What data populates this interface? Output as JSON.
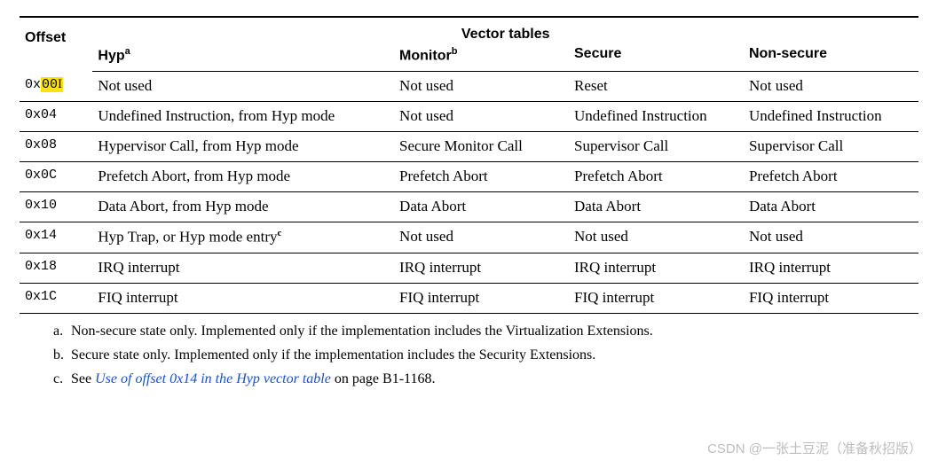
{
  "title": "Vector tables",
  "offset_header": "Offset",
  "columns": [
    {
      "label": "Hyp",
      "sup": "a"
    },
    {
      "label": "Monitor",
      "sup": "b"
    },
    {
      "label": "Secure",
      "sup": ""
    },
    {
      "label": "Non-secure",
      "sup": ""
    }
  ],
  "rows": [
    {
      "offset": "0x00",
      "offset_highlight": true,
      "hyp": "Not used",
      "monitor": "Not used",
      "secure": "Reset",
      "nonsecure": "Not used",
      "hyp_sup": ""
    },
    {
      "offset": "0x04",
      "offset_highlight": false,
      "hyp": "Undefined Instruction, from Hyp mode",
      "monitor": "Not used",
      "secure": "Undefined Instruction",
      "nonsecure": "Undefined Instruction",
      "hyp_sup": ""
    },
    {
      "offset": "0x08",
      "offset_highlight": false,
      "hyp": "Hypervisor Call, from Hyp mode",
      "monitor": "Secure Monitor Call",
      "secure": "Supervisor Call",
      "nonsecure": "Supervisor Call",
      "hyp_sup": ""
    },
    {
      "offset": "0x0C",
      "offset_highlight": false,
      "hyp": "Prefetch Abort, from Hyp mode",
      "monitor": "Prefetch Abort",
      "secure": "Prefetch Abort",
      "nonsecure": "Prefetch Abort",
      "hyp_sup": ""
    },
    {
      "offset": "0x10",
      "offset_highlight": false,
      "hyp": "Data Abort, from Hyp mode",
      "monitor": "Data Abort",
      "secure": "Data Abort",
      "nonsecure": "Data Abort",
      "hyp_sup": ""
    },
    {
      "offset": "0x14",
      "offset_highlight": false,
      "hyp": "Hyp Trap, or Hyp mode entry",
      "monitor": "Not used",
      "secure": "Not used",
      "nonsecure": "Not used",
      "hyp_sup": "c"
    },
    {
      "offset": "0x18",
      "offset_highlight": false,
      "hyp": "IRQ interrupt",
      "monitor": "IRQ interrupt",
      "secure": "IRQ interrupt",
      "nonsecure": "IRQ interrupt",
      "hyp_sup": ""
    },
    {
      "offset": "0x1C",
      "offset_highlight": false,
      "hyp": "FIQ interrupt",
      "monitor": "FIQ interrupt",
      "secure": "FIQ interrupt",
      "nonsecure": "FIQ interrupt",
      "hyp_sup": ""
    }
  ],
  "footnotes": {
    "a": "Non-secure state only. Implemented only if the implementation includes the Virtualization Extensions.",
    "b": "Secure state only. Implemented only if the implementation includes the Security Extensions.",
    "c_prefix": "See ",
    "c_link": "Use of offset 0x14 in the Hyp vector table",
    "c_suffix": " on page B1-1168."
  },
  "watermark": "CSDN @一张土豆泥（准备秋招版）",
  "chart_data": {
    "type": "table",
    "title": "Vector tables",
    "columns": [
      "Offset",
      "Hyp",
      "Monitor",
      "Secure",
      "Non-secure"
    ],
    "rows": [
      [
        "0x00",
        "Not used",
        "Not used",
        "Reset",
        "Not used"
      ],
      [
        "0x04",
        "Undefined Instruction, from Hyp mode",
        "Not used",
        "Undefined Instruction",
        "Undefined Instruction"
      ],
      [
        "0x08",
        "Hypervisor Call, from Hyp mode",
        "Secure Monitor Call",
        "Supervisor Call",
        "Supervisor Call"
      ],
      [
        "0x0C",
        "Prefetch Abort, from Hyp mode",
        "Prefetch Abort",
        "Prefetch Abort",
        "Prefetch Abort"
      ],
      [
        "0x10",
        "Data Abort, from Hyp mode",
        "Data Abort",
        "Data Abort",
        "Data Abort"
      ],
      [
        "0x14",
        "Hyp Trap, or Hyp mode entry",
        "Not used",
        "Not used",
        "Not used"
      ],
      [
        "0x18",
        "IRQ interrupt",
        "IRQ interrupt",
        "IRQ interrupt",
        "IRQ interrupt"
      ],
      [
        "0x1C",
        "FIQ interrupt",
        "FIQ interrupt",
        "FIQ interrupt",
        "FIQ interrupt"
      ]
    ]
  }
}
